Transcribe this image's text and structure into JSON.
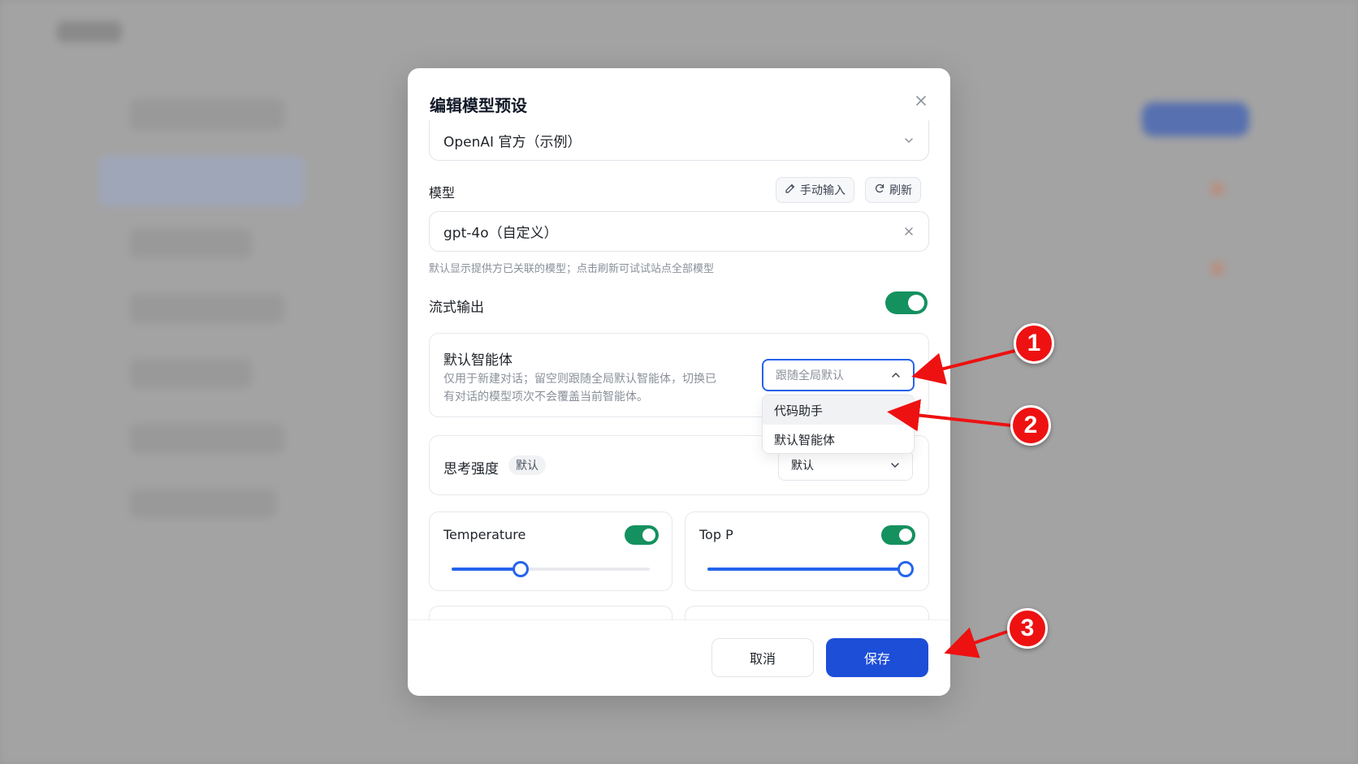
{
  "modal": {
    "title": "编辑模型预设",
    "provider_value": "OpenAI 官方（示例）",
    "model_label": "模型",
    "manual_input_label": "手动输入",
    "refresh_label": "刷新",
    "model_value": "gpt-4o（自定义）",
    "model_hint": "默认显示提供方已关联的模型；点击刷新可试试站点全部模型",
    "stream_label": "流式输出",
    "stream_enabled": true,
    "default_agent": {
      "label": "默认智能体",
      "desc_line1": "仅用于新建对话；留空则跟随全局默认智能体，切换已",
      "desc_line2": "有对话的模型项次不会覆盖当前智能体。",
      "placeholder": "跟随全局默认",
      "options": [
        "代码助手",
        "默认智能体"
      ]
    },
    "thinking": {
      "label": "思考强度",
      "badge": "默认",
      "value": "默认"
    },
    "temperature": {
      "label": "Temperature",
      "enabled": true,
      "value_fraction": 0.35
    },
    "top_p": {
      "label": "Top P",
      "enabled": true,
      "value_fraction": 1.0
    },
    "cancel_label": "取消",
    "save_label": "保存"
  },
  "annotations": [
    "1",
    "2",
    "3"
  ],
  "colors": {
    "accent": "#1d4ed8",
    "toggle": "#14915f",
    "annotation": "#ee1111"
  }
}
